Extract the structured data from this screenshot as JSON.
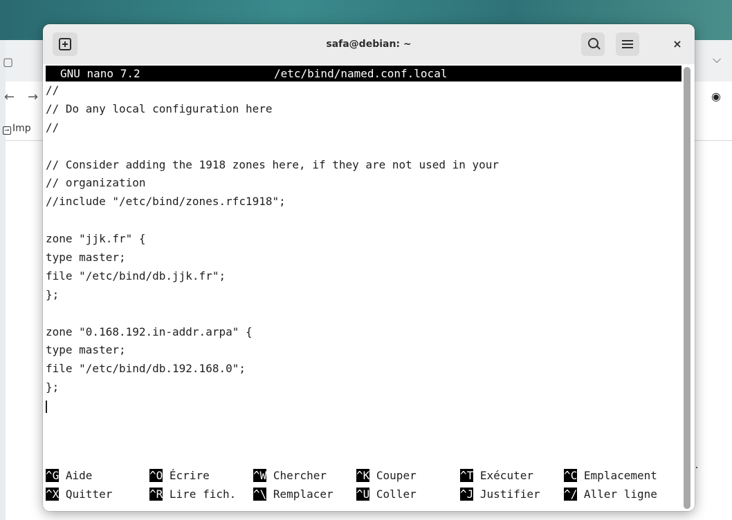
{
  "browser": {
    "back_glyph": "←",
    "forward_glyph": "→",
    "chevron_glyph": "⌵",
    "account_glyph": "◉",
    "bookmark_partial_label": "Imp",
    "bookmark_icon_glyph": "→"
  },
  "window": {
    "title": "safa@debian: ~",
    "close_glyph": "×"
  },
  "nano": {
    "app_label": "GNU nano 7.2",
    "filename": "/etc/bind/named.conf.local",
    "lines": [
      "//",
      "// Do any local configuration here",
      "//",
      "",
      "// Consider adding the 1918 zones here, if they are not used in your",
      "// organization",
      "//include \"/etc/bind/zones.rfc1918\";",
      "",
      "zone \"jjk.fr\" {",
      "type master;",
      "file \"/etc/bind/db.jjk.fr\";",
      "};",
      "",
      "zone \"0.168.192.in-addr.arpa\" {",
      "type master;",
      "file \"/etc/bind/db.192.168.0\";",
      "};"
    ],
    "shortcuts": [
      [
        {
          "key": "^G",
          "label": "Aide"
        },
        {
          "key": "^O",
          "label": "Écrire"
        },
        {
          "key": "^W",
          "label": "Chercher"
        },
        {
          "key": "^K",
          "label": "Couper"
        },
        {
          "key": "^T",
          "label": "Exécuter"
        },
        {
          "key": "^C",
          "label": "Emplacement"
        }
      ],
      [
        {
          "key": "^X",
          "label": "Quitter"
        },
        {
          "key": "^R",
          "label": "Lire fich."
        },
        {
          "key": "^\\",
          "label": "Remplacer"
        },
        {
          "key": "^U",
          "label": "Coller"
        },
        {
          "key": "^J",
          "label": "Justifier"
        },
        {
          "key": "^/",
          "label": "Aller ligne"
        }
      ]
    ]
  }
}
